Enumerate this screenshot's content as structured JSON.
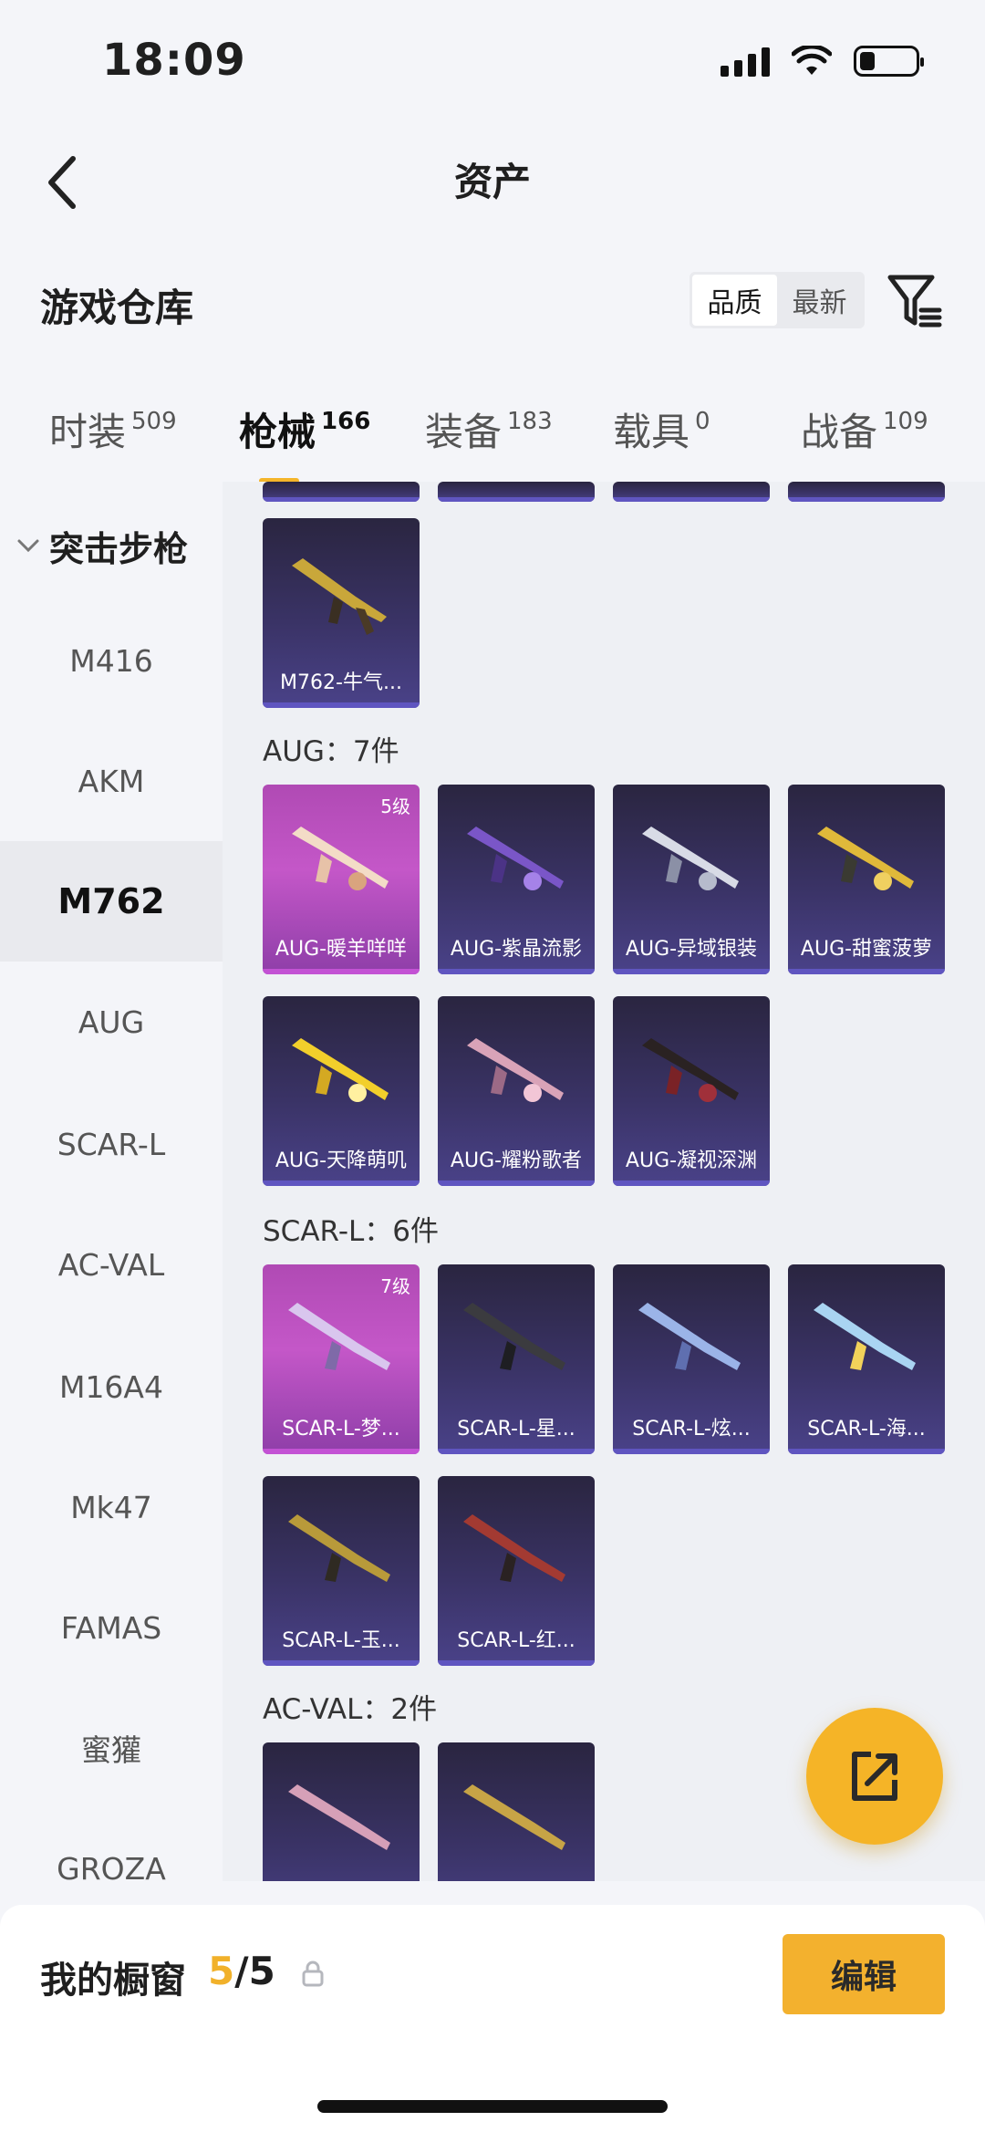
{
  "status_bar": {
    "time": "18:09"
  },
  "header": {
    "title": "资产"
  },
  "section": {
    "title": "游戏仓库",
    "sort_options": [
      "品质",
      "最新"
    ],
    "active_sort": "品质"
  },
  "tabs": [
    {
      "label": "时装",
      "count": "509"
    },
    {
      "label": "枪械",
      "count": "166"
    },
    {
      "label": "装备",
      "count": "183"
    },
    {
      "label": "载具",
      "count": "0"
    },
    {
      "label": "战备",
      "count": "109"
    }
  ],
  "sidebar": {
    "group": "突击步枪",
    "items": [
      "M416",
      "AKM",
      "M762",
      "AUG",
      "SCAR-L",
      "AC-VAL",
      "M16A4",
      "Mk47",
      "FAMAS",
      "蜜獾",
      "GROZA"
    ],
    "active": "M762"
  },
  "content": {
    "m762_items": [
      "M762-牛气..."
    ],
    "aug": {
      "label": "AUG：7件",
      "items": [
        "AUG-暖羊咩咩",
        "AUG-紫晶流影",
        "AUG-异域银装",
        "AUG-甜蜜菠萝",
        "AUG-天降萌叽",
        "AUG-耀粉歌者",
        "AUG-凝视深渊"
      ],
      "badge": "5级"
    },
    "scar": {
      "label": "SCAR-L：6件",
      "items": [
        "SCAR-L-梦...",
        "SCAR-L-星...",
        "SCAR-L-炫...",
        "SCAR-L-海...",
        "SCAR-L-玉...",
        "SCAR-L-红..."
      ],
      "badge": "7级"
    },
    "acval": {
      "label": "AC-VAL：2件"
    }
  },
  "bottom": {
    "showcase_label": "我的橱窗",
    "count_current": "5",
    "count_total": "/5",
    "edit_label": "编辑"
  },
  "colors": {
    "accent": "#f3b12e",
    "card_bg": "#3a3366",
    "epic_bg": "#c457c8"
  },
  "icons": [
    "back-icon",
    "filter-icon",
    "chevron-down-icon",
    "share-icon",
    "lock-icon",
    "signal-icon",
    "wifi-icon",
    "battery-icon"
  ]
}
